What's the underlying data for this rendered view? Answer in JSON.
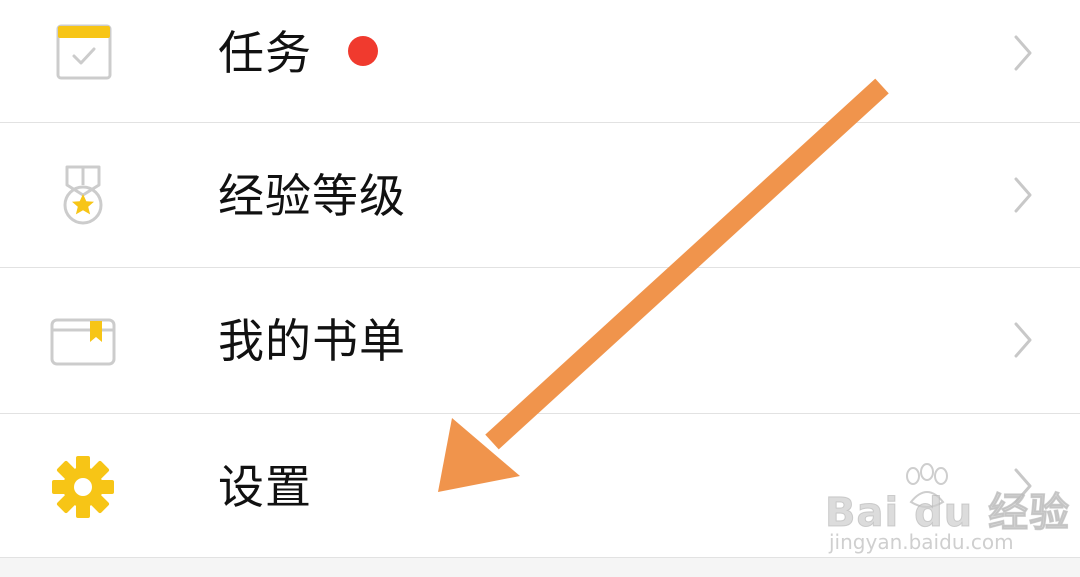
{
  "menu": {
    "items": [
      {
        "label": "任务",
        "icon": "calendar-check-icon",
        "has_badge": true
      },
      {
        "label": "经验等级",
        "icon": "medal-star-icon",
        "has_badge": false
      },
      {
        "label": "我的书单",
        "icon": "bookmark-card-icon",
        "has_badge": false
      },
      {
        "label": "设置",
        "icon": "gear-icon",
        "has_badge": false
      }
    ]
  },
  "colors": {
    "badge": "#f03a2e",
    "icon_yellow": "#f7c516",
    "icon_gray": "#cccccc",
    "arrow": "#f0944c",
    "chevron": "#c8c8c8"
  },
  "watermark": {
    "logo": "Bai du 经验",
    "url": "jingyan.baidu.com"
  }
}
